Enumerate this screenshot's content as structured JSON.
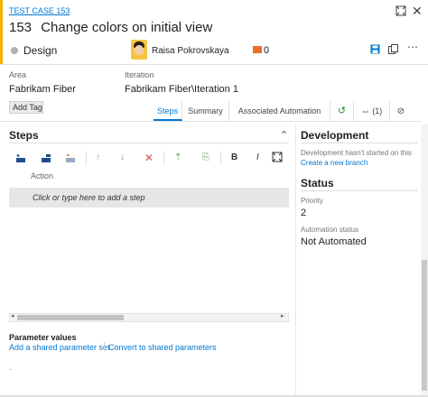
{
  "work_item": {
    "type_link": "TEST CASE 153",
    "id": "153",
    "title": "Change colors on initial view",
    "state": "Design",
    "assignee": "Raisa Pokrovskaya",
    "comment_count": "0"
  },
  "fields": {
    "area_label": "Area",
    "area_value": "Fabrikam Fiber",
    "iteration_label": "Iteration",
    "iteration_value": "Fabrikam Fiber\\Iteration 1",
    "add_tag": "Add Tag"
  },
  "tabs": [
    {
      "label": "Steps"
    },
    {
      "label": "Summary"
    },
    {
      "label": "Associated Automation"
    },
    {
      "label": "(1)"
    }
  ],
  "steps": {
    "title": "Steps",
    "column_action": "Action",
    "placeholder": "Click or type here to add a step"
  },
  "parameters": {
    "title": "Parameter values",
    "add_shared": "Add a shared parameter set",
    "convert": "Convert to shared parameters"
  },
  "development": {
    "title": "Development",
    "message": "Development hasn't started on this",
    "link": "Create a new branch"
  },
  "status": {
    "title": "Status",
    "priority_label": "Priority",
    "priority_value": "2",
    "automation_label": "Automation status",
    "automation_value": "Not Automated"
  },
  "colors": {
    "accent": "#0078d4",
    "state_bar": "#f0b400",
    "comment": "#e8702a"
  }
}
